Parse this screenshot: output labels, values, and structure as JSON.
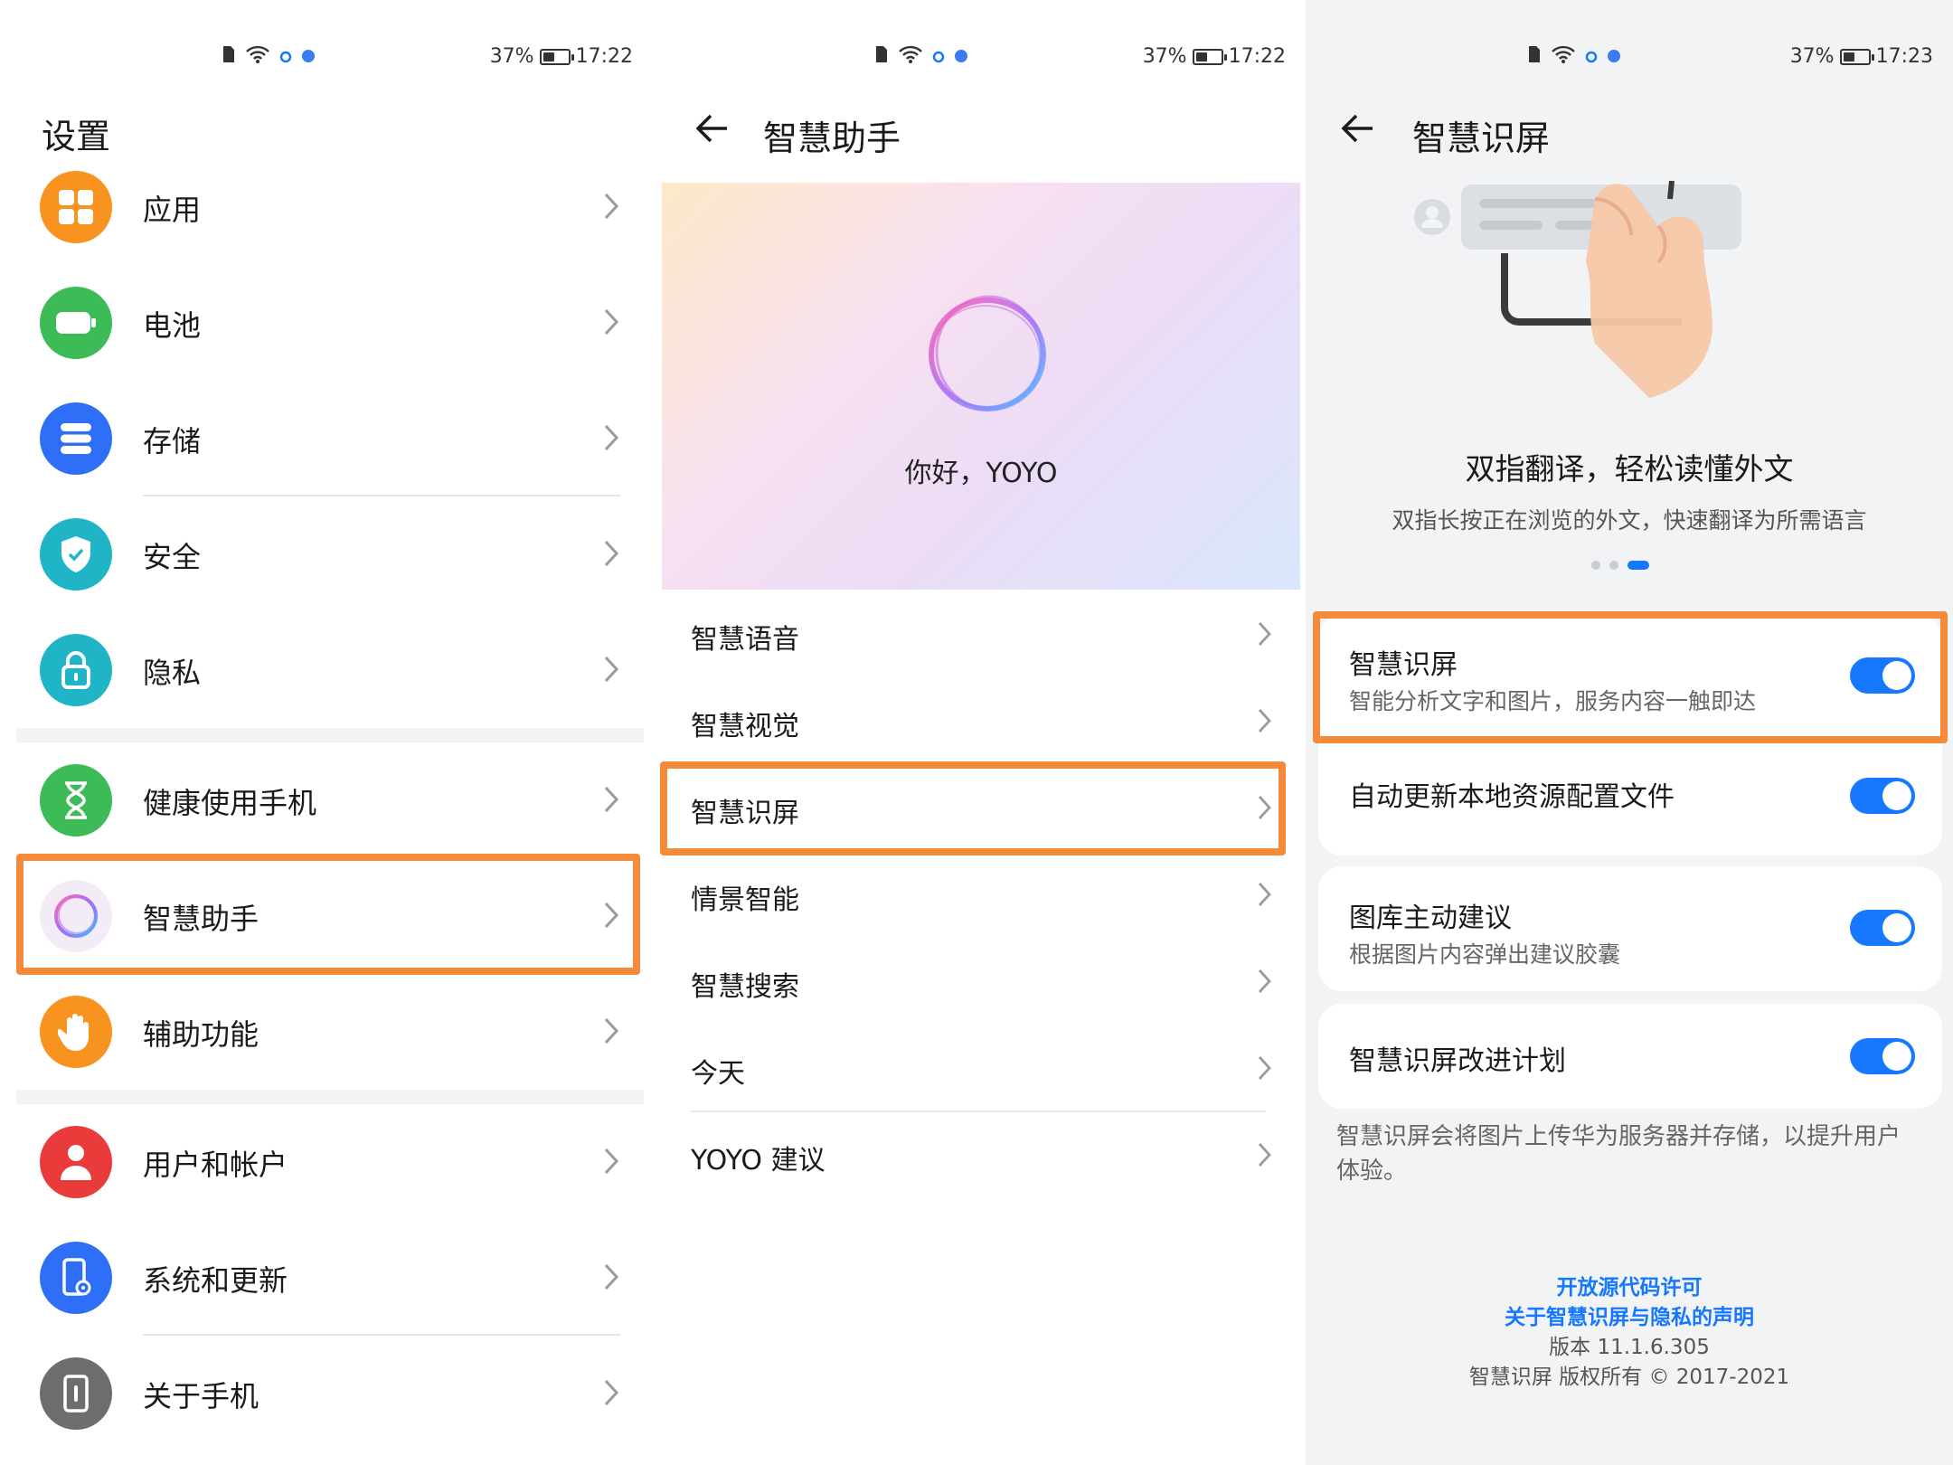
{
  "status": {
    "p1": {
      "battery": "37%",
      "time": "17:22"
    },
    "p2": {
      "battery": "37%",
      "time": "17:22"
    },
    "p3": {
      "battery": "37%",
      "time": "17:23"
    }
  },
  "settings": {
    "title": "设置",
    "items": [
      {
        "label": "应用",
        "icon": "apps-icon",
        "color": "#f7931e"
      },
      {
        "label": "电池",
        "icon": "battery-icon",
        "color": "#3dbb56"
      },
      {
        "label": "存储",
        "icon": "storage-icon",
        "color": "#2f6ef6"
      },
      {
        "label": "安全",
        "icon": "shield-icon",
        "color": "#1fb5c7"
      },
      {
        "label": "隐私",
        "icon": "lock-icon",
        "color": "#1fb5c7"
      },
      {
        "label": "健康使用手机",
        "icon": "hourglass-icon",
        "color": "#3dbb56"
      },
      {
        "label": "智慧助手",
        "icon": "assistant-ring-icon",
        "color": "#f3ecf7"
      },
      {
        "label": "辅助功能",
        "icon": "hand-icon",
        "color": "#f7931e"
      },
      {
        "label": "用户和帐户",
        "icon": "user-icon",
        "color": "#ea3b3b"
      },
      {
        "label": "系统和更新",
        "icon": "phone-update-icon",
        "color": "#2f6ef6"
      },
      {
        "label": "关于手机",
        "icon": "phone-info-icon",
        "color": "#6d6d6d"
      }
    ]
  },
  "assistant": {
    "title": "智慧助手",
    "greeting": "你好，YOYO",
    "items": [
      {
        "label": "智慧语音"
      },
      {
        "label": "智慧视觉"
      },
      {
        "label": "智慧识屏"
      },
      {
        "label": "情景智能"
      },
      {
        "label": "智慧搜索"
      },
      {
        "label": "今天"
      },
      {
        "label": "YOYO 建议"
      }
    ]
  },
  "screen_recognition": {
    "title": "智慧识屏",
    "hero_title": "双指翻译，轻松读懂外文",
    "hero_subtitle": "双指长按正在浏览的外文，快速翻译为所需语言",
    "carousel": {
      "count": 3,
      "active": 3
    },
    "cards": [
      {
        "label": "智慧识屏",
        "sub": "智能分析文字和图片，服务内容一触即达",
        "on": true
      },
      {
        "label": "自动更新本地资源配置文件",
        "on": true
      },
      {
        "label": "图库主动建议",
        "sub": "根据图片内容弹出建议胶囊",
        "on": true
      },
      {
        "label": "智慧识屏改进计划",
        "on": true
      }
    ],
    "note": "智慧识屏会将图片上传华为服务器并存储，以提升用户体验。",
    "footer": {
      "link1": "开放源代码许可",
      "link2": "关于智慧识屏与隐私的声明",
      "version": "版本 11.1.6.305",
      "copyright": "智慧识屏 版权所有 © 2017-2021"
    }
  },
  "colors": {
    "accent": "#1677ff",
    "highlight": "#f58a3b"
  }
}
